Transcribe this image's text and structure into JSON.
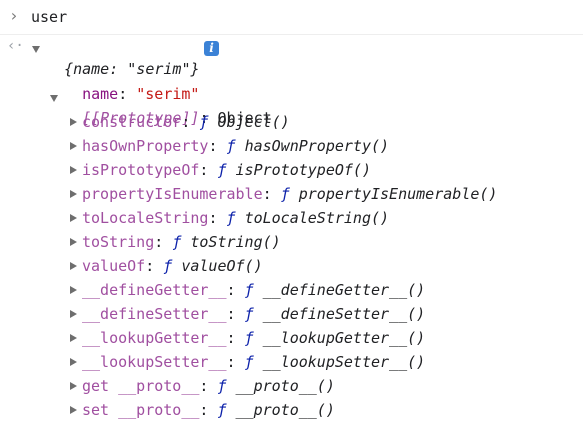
{
  "console": {
    "command_prompt": "›",
    "command": "user",
    "result_marker": "‹·",
    "preview": "{name: \"serim\"}",
    "info_badge": "i",
    "name_key": "name",
    "name_value": "\"serim\"",
    "prototype_key": "[[Prototype]]",
    "prototype_value": "Object",
    "members": [
      {
        "key": "constructor",
        "f": "ƒ",
        "fn": "Object()"
      },
      {
        "key": "hasOwnProperty",
        "f": "ƒ",
        "fn": "hasOwnProperty()"
      },
      {
        "key": "isPrototypeOf",
        "f": "ƒ",
        "fn": "isPrototypeOf()"
      },
      {
        "key": "propertyIsEnumerable",
        "f": "ƒ",
        "fn": "propertyIsEnumerable()"
      },
      {
        "key": "toLocaleString",
        "f": "ƒ",
        "fn": "toLocaleString()"
      },
      {
        "key": "toString",
        "f": "ƒ",
        "fn": "toString()"
      },
      {
        "key": "valueOf",
        "f": "ƒ",
        "fn": "valueOf()"
      },
      {
        "key": "__defineGetter__",
        "f": "ƒ",
        "fn": "__defineGetter__()"
      },
      {
        "key": "__defineSetter__",
        "f": "ƒ",
        "fn": "__defineSetter__()"
      },
      {
        "key": "__lookupGetter__",
        "f": "ƒ",
        "fn": "__lookupGetter__()"
      },
      {
        "key": "__lookupSetter__",
        "f": "ƒ",
        "fn": "__lookupSetter__()"
      },
      {
        "key": "get __proto__",
        "f": "ƒ",
        "fn": "__proto__()"
      },
      {
        "key": "set __proto__",
        "f": "ƒ",
        "fn": "__proto__()"
      }
    ]
  }
}
